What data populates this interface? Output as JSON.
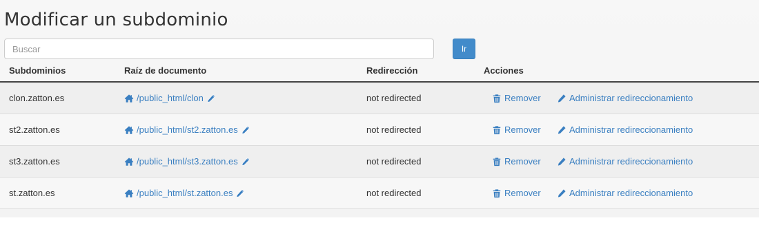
{
  "page": {
    "title": "Modificar un subdominio"
  },
  "search": {
    "placeholder": "Buscar",
    "value": "",
    "button_label": "Ir"
  },
  "table": {
    "headers": [
      "Subdominios",
      "Raíz de documento",
      "Redirección",
      "Acciones"
    ],
    "rows": [
      {
        "subdomain": "clon.zatton.es",
        "docroot": "/public_html/clon",
        "redirect": "not redirected",
        "remove": "Remover",
        "manage": "Administrar redireccionamiento"
      },
      {
        "subdomain": "st2.zatton.es",
        "docroot": "/public_html/st2.zatton.es",
        "redirect": "not redirected",
        "remove": "Remover",
        "manage": "Administrar redireccionamiento"
      },
      {
        "subdomain": "st3.zatton.es",
        "docroot": "/public_html/st3.zatton.es",
        "redirect": "not redirected",
        "remove": "Remover",
        "manage": "Administrar redireccionamiento"
      },
      {
        "subdomain": "st.zatton.es",
        "docroot": "/public_html/st.zatton.es",
        "redirect": "not redirected",
        "remove": "Remover",
        "manage": "Administrar redireccionamiento"
      }
    ]
  },
  "icons": {
    "docroot": "home-icon",
    "edit": "pencil-icon",
    "remove": "trash-icon"
  },
  "colors": {
    "link": "#3a7fc1",
    "button": "#428bca"
  }
}
